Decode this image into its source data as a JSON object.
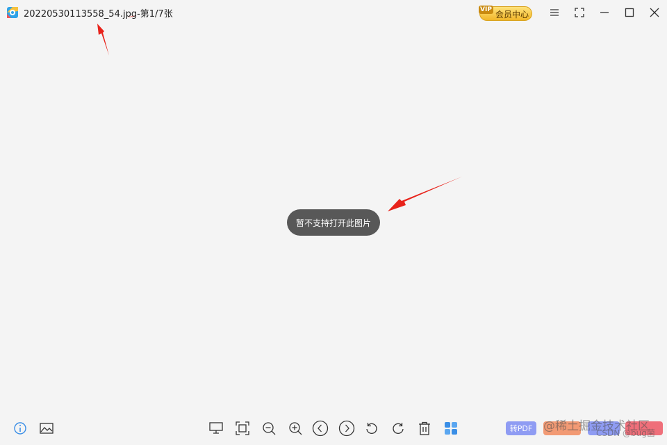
{
  "window": {
    "title": "20220530113558_54.jpg-第1/7张",
    "vip_badge": "VIP",
    "vip_label": "会员中心"
  },
  "message": {
    "toast": "暂不支持打开此图片"
  },
  "toolbar": {
    "left": [
      {
        "name": "info-icon"
      },
      {
        "name": "image-icon"
      }
    ],
    "center": [
      {
        "name": "monitor-icon"
      },
      {
        "name": "fit-screen-icon"
      },
      {
        "name": "zoom-out-icon"
      },
      {
        "name": "zoom-in-icon"
      },
      {
        "name": "previous-icon"
      },
      {
        "name": "next-icon"
      },
      {
        "name": "rotate-left-icon"
      },
      {
        "name": "rotate-right-icon"
      },
      {
        "name": "delete-icon"
      },
      {
        "name": "grid-icon"
      }
    ],
    "to_pdf": "转PDF"
  },
  "watermark": {
    "juejin": "@稀土掘金技术社区",
    "csdn": "CSDN @bug菌"
  },
  "colors": {
    "background": "#f4f4f4",
    "toast": "#585858",
    "arrow": "#e8231b",
    "accent_blue": "#3a8ee6",
    "pdf_pill": "#8f9cf3"
  }
}
